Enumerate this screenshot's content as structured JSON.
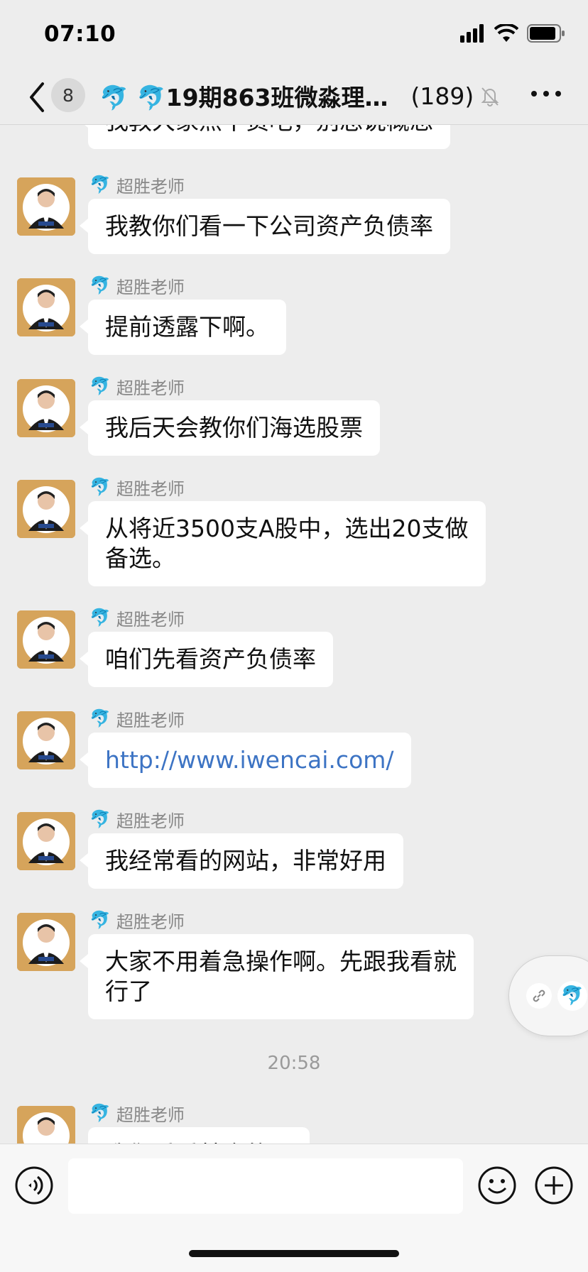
{
  "status_bar": {
    "time": "07:10"
  },
  "header": {
    "unread_count": "8",
    "title": "🐬 🐬19期863班微淼理…",
    "member_count": "(189)"
  },
  "top_partial_message": {
    "text": "我教大家点干货吧，别总说概念"
  },
  "messages": [
    {
      "sender": "超胜老师",
      "text": "我教你们看一下公司资产负债率"
    },
    {
      "sender": "超胜老师",
      "text": "提前透露下啊。"
    },
    {
      "sender": "超胜老师",
      "text": "我后天会教你们海选股票"
    },
    {
      "sender": "超胜老师",
      "text": "从将近3500支A股中，选出20支做",
      "text2": "备选。"
    },
    {
      "sender": "超胜老师",
      "text": "咱们先看资产负债率"
    },
    {
      "sender": "超胜老师",
      "text": "http://www.iwencai.com/"
    },
    {
      "sender": "超胜老师",
      "text": "我经常看的网站，非常好用"
    },
    {
      "sender": "超胜老师",
      "text": "大家不用着急操作啊。先跟我看就",
      "text2": "行了"
    },
    {
      "sender": "超胜老师",
      "text": "我们看看其余的吧"
    }
  ],
  "time_separator": "20:58",
  "input": {
    "placeholder": ""
  },
  "icons": {
    "back": "chevron-left-icon",
    "mute": "bell-slash-icon",
    "more": "more-dots-icon",
    "voice": "voice-icon",
    "emoji": "emoji-icon",
    "plus": "plus-icon",
    "link": "link-icon"
  },
  "colors": {
    "background": "#ededed",
    "bubble": "#ffffff",
    "link": "#3d74c4",
    "avatar_bg": "#d6a45b"
  }
}
